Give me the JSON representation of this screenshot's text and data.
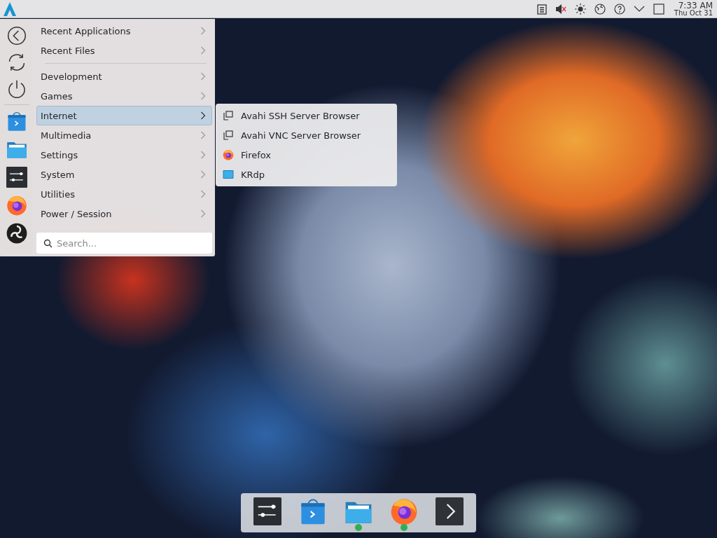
{
  "panel": {
    "clock": {
      "time": "7:33 AM",
      "date": "Thu Oct 31"
    }
  },
  "menu": {
    "sidebar": [
      {
        "kind": "back"
      },
      {
        "kind": "refresh"
      },
      {
        "kind": "power"
      },
      {
        "kind": "store"
      },
      {
        "kind": "folder"
      },
      {
        "kind": "sliders"
      },
      {
        "kind": "firefox"
      },
      {
        "kind": "obs"
      }
    ],
    "recent": [
      {
        "label": "Recent Applications",
        "selected": false
      },
      {
        "label": "Recent Files",
        "selected": false
      }
    ],
    "categories": [
      {
        "label": "Development",
        "selected": false
      },
      {
        "label": "Games",
        "selected": false
      },
      {
        "label": "Internet",
        "selected": true
      },
      {
        "label": "Multimedia",
        "selected": false
      },
      {
        "label": "Settings",
        "selected": false
      },
      {
        "label": "System",
        "selected": false
      },
      {
        "label": "Utilities",
        "selected": false
      },
      {
        "label": "Power / Session",
        "selected": false
      }
    ],
    "search": {
      "placeholder": "Search..."
    }
  },
  "submenu": {
    "items": [
      {
        "label": "Avahi SSH Server Browser",
        "kind": "remote"
      },
      {
        "label": "Avahi VNC Server Browser",
        "kind": "remote"
      },
      {
        "label": "Firefox",
        "kind": "firefox"
      },
      {
        "label": "KRdp",
        "kind": "krdp"
      }
    ]
  },
  "dock": {
    "items": [
      {
        "kind": "sliders",
        "badge": false
      },
      {
        "kind": "store",
        "badge": false
      },
      {
        "kind": "folder",
        "badge": true
      },
      {
        "kind": "firefox",
        "badge": true
      },
      {
        "kind": "terminal",
        "badge": false
      }
    ]
  }
}
